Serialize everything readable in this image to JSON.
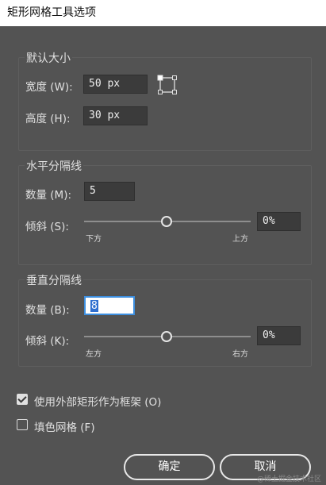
{
  "window": {
    "title": "矩形网格工具选项"
  },
  "default_size": {
    "title": "默认大小",
    "width_label": "宽度 (W):",
    "width_value": "50 px",
    "height_label": "高度 (H):",
    "height_value": "30 px",
    "anchor_icon": "reference-point-icon"
  },
  "horizontal_dividers": {
    "title": "水平分隔线",
    "count_label": "数量 (M):",
    "count_value": "5",
    "skew_label": "倾斜 (S):",
    "skew_value": "0%",
    "skew_level": 0,
    "left_tick": "下方",
    "right_tick": "上方"
  },
  "vertical_dividers": {
    "title": "垂直分隔线",
    "count_label": "数量 (B):",
    "count_value": "8",
    "skew_label": "倾斜 (K):",
    "skew_value": "0%",
    "skew_level": 0,
    "left_tick": "左方",
    "right_tick": "右方"
  },
  "options": {
    "use_outer_rect_label": "使用外部矩形作为框架 (O)",
    "use_outer_rect_checked": true,
    "fill_grid_label": "填色网格 (F)",
    "fill_grid_checked": false
  },
  "buttons": {
    "ok": "确定",
    "cancel": "取消"
  },
  "watermark": "@稀土掘金技术社区",
  "colors": {
    "background": "#535353",
    "field": "#3b3b3b",
    "focus": "#3d8fe0"
  }
}
